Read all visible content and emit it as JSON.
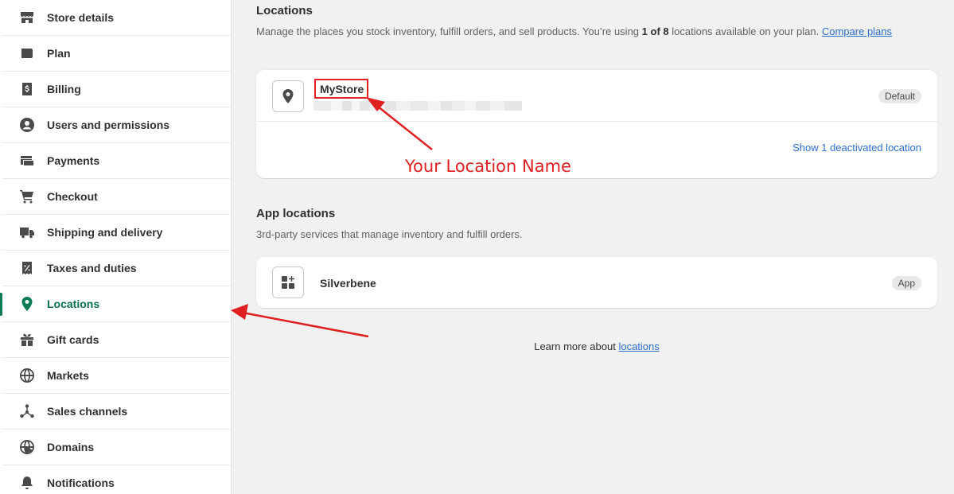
{
  "sidebar": {
    "items": [
      {
        "label": "Store details",
        "icon": "store-icon"
      },
      {
        "label": "Plan",
        "icon": "plan-icon"
      },
      {
        "label": "Billing",
        "icon": "billing-icon"
      },
      {
        "label": "Users and permissions",
        "icon": "user-icon"
      },
      {
        "label": "Payments",
        "icon": "payments-icon"
      },
      {
        "label": "Checkout",
        "icon": "cart-icon"
      },
      {
        "label": "Shipping and delivery",
        "icon": "truck-icon"
      },
      {
        "label": "Taxes and duties",
        "icon": "tax-icon"
      },
      {
        "label": "Locations",
        "icon": "location-pin-icon",
        "active": true
      },
      {
        "label": "Gift cards",
        "icon": "gift-icon"
      },
      {
        "label": "Markets",
        "icon": "globe-icon"
      },
      {
        "label": "Sales channels",
        "icon": "channels-icon"
      },
      {
        "label": "Domains",
        "icon": "domain-globe-icon"
      },
      {
        "label": "Notifications",
        "icon": "bell-icon"
      }
    ]
  },
  "locations": {
    "title": "Locations",
    "desc_prefix": "Manage the places you stock inventory, fulfill orders, and sell products. You’re using ",
    "desc_bold": "1 of 8",
    "desc_suffix": " locations available on your plan. ",
    "compare_link": "Compare plans",
    "location_name": "MyStore",
    "default_badge": "Default",
    "show_deactivated": "Show 1 deactivated location"
  },
  "annotation": {
    "text": "Your Location Name",
    "color": "#e02020"
  },
  "app_locations": {
    "title": "App locations",
    "desc": "3rd-party services that manage inventory and fulfill orders.",
    "app_name": "Silverbene",
    "app_badge": "App"
  },
  "footer": {
    "learn_prefix": "Learn more about ",
    "learn_link": "locations"
  },
  "colors": {
    "accent": "#0b7a57",
    "link": "#2c6ecb",
    "background": "#f1f1f1"
  }
}
